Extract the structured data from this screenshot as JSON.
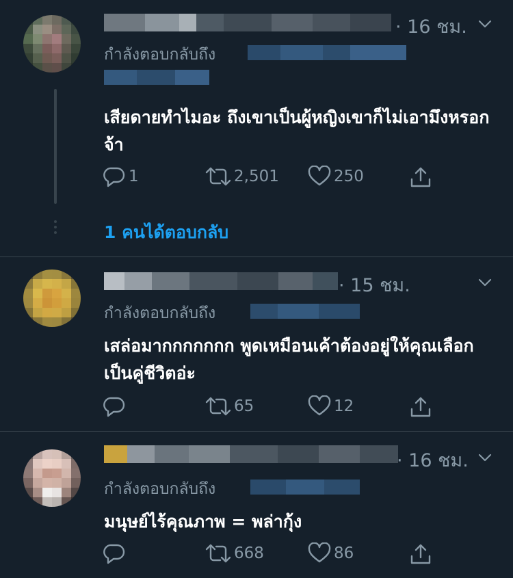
{
  "tweets": [
    {
      "time": "· 16 ชม.",
      "replying_label": "กำลังตอบกลับถึง",
      "text": "เสียดายทำไมอะ ถึงเขาเป็นผู้หญิงเขาก็ไม่เอามึงหรอกจ้า",
      "reply_count": "1",
      "retweet_count": "2,501",
      "like_count": "250",
      "more_replies": "1 คนได้ตอบกลับ"
    },
    {
      "time": "· 15 ชม.",
      "replying_label": "กำลังตอบกลับถึง",
      "text": "เสล่อมากกกกกกก พูดเหมือนเค้าต้องอยู่ให้คุณเลือกเป็นคู่ชีวิตอ่ะ",
      "reply_count": "",
      "retweet_count": "65",
      "like_count": "12"
    },
    {
      "time": "· 16 ชม.",
      "replying_label": "กำลังตอบกลับถึง",
      "text": "มนุษย์ไร้คุณภาพ = พล่ากุ้ง",
      "reply_count": "",
      "retweet_count": "668",
      "like_count": "86"
    }
  ],
  "colors": {
    "background": "#15202b",
    "divider": "#38444d",
    "secondary_text": "#8899a6",
    "accent": "#1da1f2"
  },
  "icons": [
    "reply-icon",
    "retweet-icon",
    "like-icon",
    "share-icon",
    "chevron-down-icon"
  ]
}
